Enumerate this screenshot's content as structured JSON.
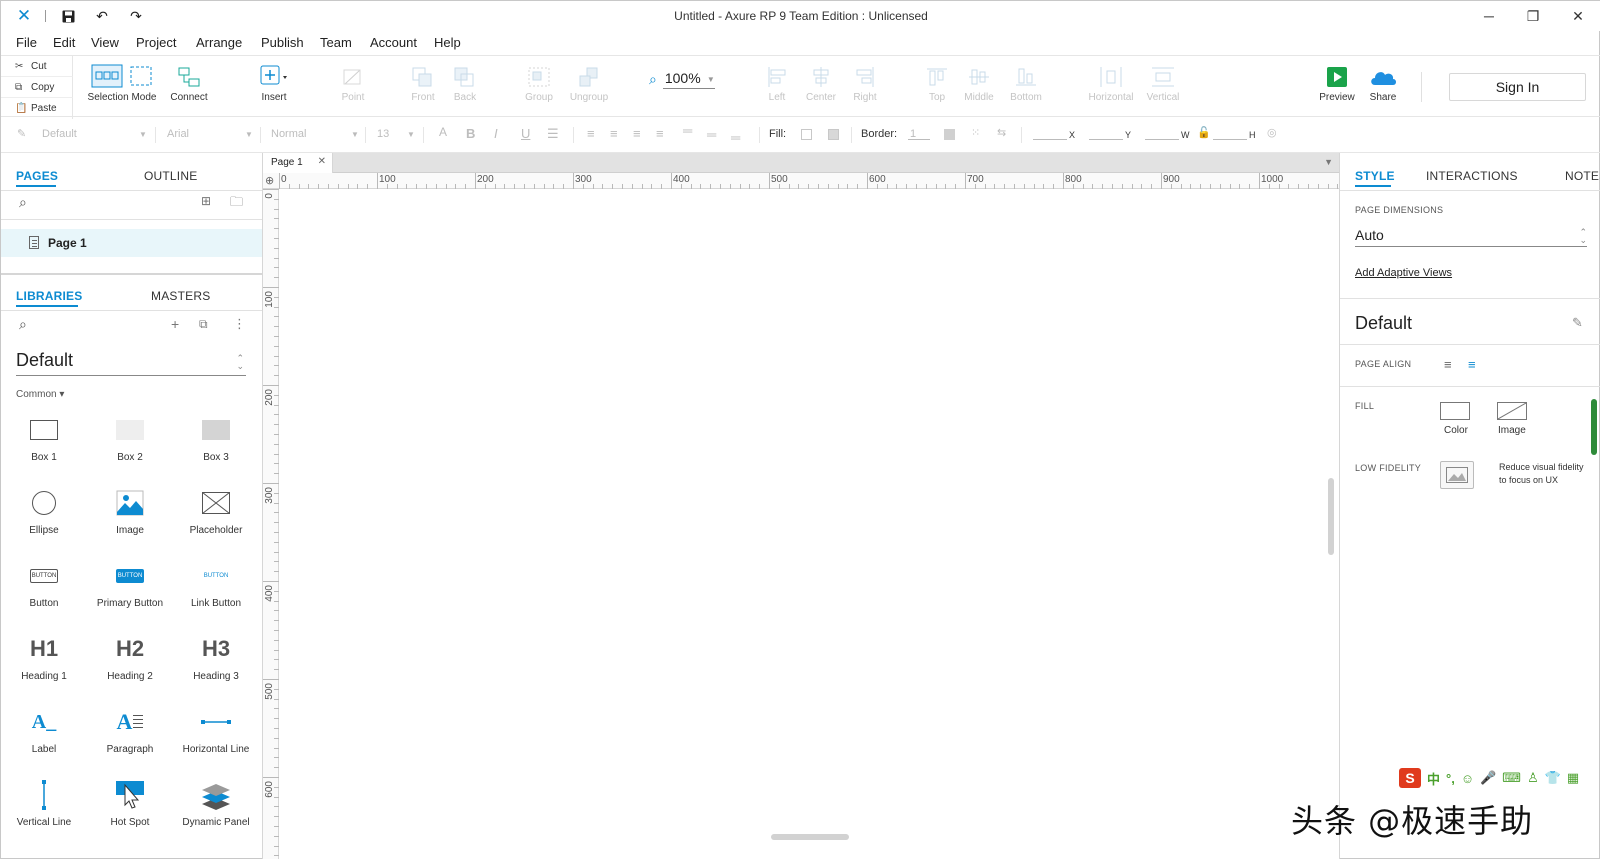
{
  "window": {
    "title": "Untitled - Axure RP 9 Team Edition : Unlicensed",
    "controls": {
      "minimize": "minimize-icon",
      "restore": "restore-icon",
      "close": "close-icon"
    }
  },
  "menu": [
    "File",
    "Edit",
    "View",
    "Project",
    "Arrange",
    "Publish",
    "Team",
    "Account",
    "Help"
  ],
  "clipboard": {
    "cut": "Cut",
    "copy": "Copy",
    "paste": "Paste"
  },
  "toolbar": {
    "selection_mode": "Selection Mode",
    "connect": "Connect",
    "insert": "Insert",
    "point": "Point",
    "front": "Front",
    "back": "Back",
    "group": "Group",
    "ungroup": "Ungroup",
    "zoom": "100%",
    "left": "Left",
    "center": "Center",
    "right": "Right",
    "top": "Top",
    "middle": "Middle",
    "bottom": "Bottom",
    "horizontal": "Horizontal",
    "vertical": "Vertical",
    "preview": "Preview",
    "share": "Share",
    "sign_in": "Sign In"
  },
  "format": {
    "style": "Default",
    "font": "Arial",
    "weight": "Normal",
    "size": "13",
    "fill_label": "Fill:",
    "border_label": "Border:",
    "border_value": "1",
    "x": "X",
    "y": "Y",
    "w": "W",
    "h": "H"
  },
  "pages_panel": {
    "tabs": [
      "PAGES",
      "OUTLINE"
    ],
    "pages": [
      "Page 1"
    ]
  },
  "libraries_panel": {
    "tabs": [
      "LIBRARIES",
      "MASTERS"
    ],
    "library": "Default",
    "group": "Common ▾",
    "widgets": [
      "Box 1",
      "Box 2",
      "Box 3",
      "Ellipse",
      "Image",
      "Placeholder",
      "Button",
      "Primary Button",
      "Link Button",
      "Heading 1",
      "Heading 2",
      "Heading 3",
      "Label",
      "Paragraph",
      "Horizontal Line",
      "Vertical Line",
      "Hot Spot",
      "Dynamic Panel"
    ],
    "widget_text": {
      "button": "BUTTON",
      "primary": "BUTTON",
      "link": "BUTTON",
      "h1": "H1",
      "h2": "H2",
      "h3": "H3",
      "label": "A_",
      "paragraph": "A"
    }
  },
  "canvas": {
    "tab": "Page 1",
    "ruler_h": [
      "0",
      "100",
      "200",
      "300",
      "400",
      "500",
      "600",
      "700",
      "800",
      "900",
      "1000"
    ],
    "ruler_v": [
      "0",
      "100",
      "200",
      "300",
      "400",
      "500",
      "600"
    ]
  },
  "style_panel": {
    "tabs": [
      "STYLE",
      "INTERACTIONS",
      "NOTES"
    ],
    "page_dimensions_label": "PAGE DIMENSIONS",
    "page_dimensions": "Auto",
    "add_adaptive": "Add Adaptive Views",
    "style_name": "Default",
    "page_align_label": "PAGE ALIGN",
    "fill_label": "FILL",
    "fill_color": "Color",
    "fill_image": "Image",
    "low_fidelity_label": "LOW FIDELITY",
    "low_fidelity_text_1": "Reduce visual fidelity",
    "low_fidelity_text_2": "to focus on UX"
  },
  "ime": {
    "logo": "S",
    "mode": "中"
  },
  "watermark": "头条 @极速手助",
  "colors": {
    "accent": "#0d8bd1",
    "preview": "#1aa34a",
    "share": "#1f8fe0",
    "ime": "#e03a1d"
  }
}
